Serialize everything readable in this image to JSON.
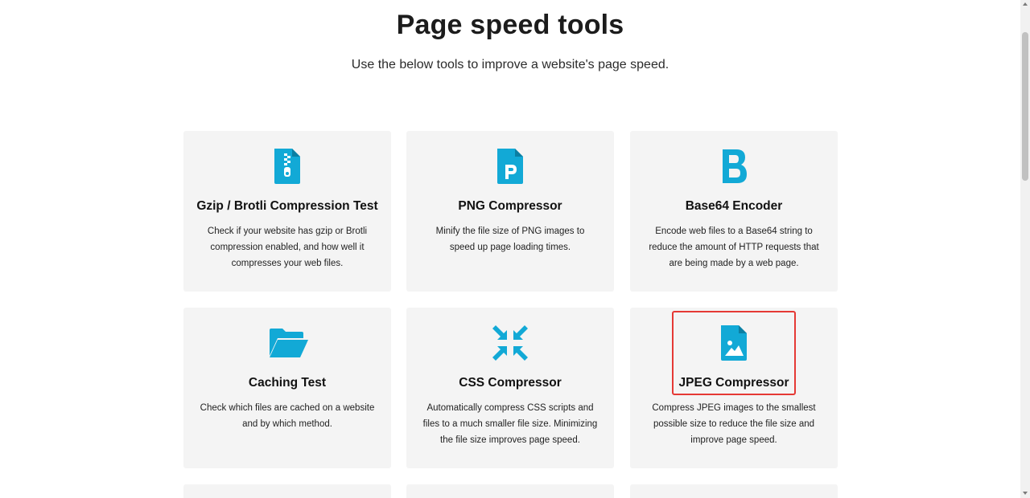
{
  "page": {
    "title": "Page speed tools",
    "subtitle": "Use the below tools to improve a website's page speed."
  },
  "theme": {
    "accent": "#12a9d6",
    "card_bg": "#f4f4f4",
    "highlight": "#e53935"
  },
  "tools": [
    {
      "icon": "zip-file-icon",
      "title": "Gzip / Brotli Compression Test",
      "description": "Check if your website has gzip or Brotli compression enabled, and how well it compresses your web files."
    },
    {
      "icon": "png-file-icon",
      "title": "PNG Compressor",
      "description": "Minify the file size of PNG images to speed up page loading times."
    },
    {
      "icon": "letter-b-icon",
      "title": "Base64 Encoder",
      "description": "Encode web files to a Base64 string to reduce the amount of HTTP requests that are being made by a web page."
    },
    {
      "icon": "folder-open-icon",
      "title": "Caching Test",
      "description": "Check which files are cached on a website and by which method."
    },
    {
      "icon": "compress-arrows-icon",
      "title": "CSS Compressor",
      "description": "Automatically compress CSS scripts and files to a much smaller file size. Minimizing the file size improves page speed."
    },
    {
      "icon": "image-file-icon",
      "title": "JPEG Compressor",
      "description": "Compress JPEG images to the smallest possible size to reduce the file size and improve page speed."
    }
  ]
}
